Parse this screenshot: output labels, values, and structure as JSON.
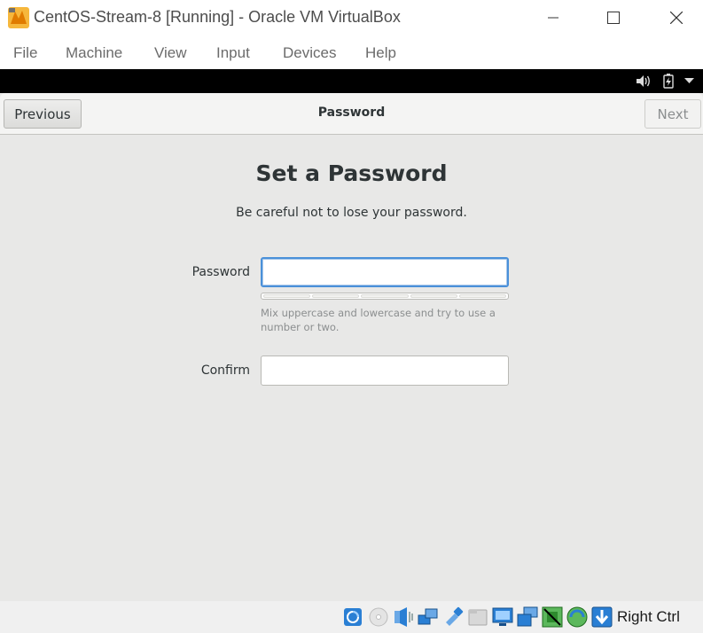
{
  "window": {
    "title": "CentOS-Stream-8 [Running] - Oracle VM VirtualBox",
    "controls": [
      "minimize-icon",
      "maximize-icon",
      "close-icon"
    ]
  },
  "menu": {
    "items": [
      "File",
      "Machine",
      "View",
      "Input",
      "Devices",
      "Help"
    ]
  },
  "guest_topbar": {
    "icons": [
      "volume-icon",
      "battery-icon",
      "dropdown-arrow-icon"
    ]
  },
  "header": {
    "previous_label": "Previous",
    "title": "Password",
    "next_label": "Next"
  },
  "page": {
    "heading": "Set a Password",
    "subtitle": "Be careful not to lose your password."
  },
  "form": {
    "password_label": "Password",
    "password_value": "",
    "confirm_label": "Confirm",
    "confirm_value": "",
    "strength_segments": 5,
    "strength_level": 0,
    "hint": "Mix uppercase and lowercase and try to use a number or two."
  },
  "statusbar": {
    "icons": [
      "hard-disk-icon",
      "optical-drive-icon",
      "audio-icon",
      "network-icon",
      "usb-icon",
      "shared-folders-icon",
      "display-icon",
      "video-capture-icon",
      "cpu-icon",
      "mouse-integration-icon",
      "host-key-arrow-icon"
    ],
    "host_key": "Right Ctrl"
  },
  "colors": {
    "accent": "#4a90d9",
    "guest_bg": "#e8e8e7",
    "header_bg": "#f4f4f3"
  }
}
